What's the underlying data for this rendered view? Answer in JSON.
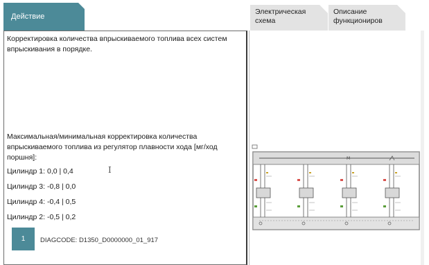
{
  "tabs": {
    "action": "Действие",
    "wiring": "Электрическая схема",
    "function": "Описание функциониров"
  },
  "content": {
    "message_top": "Корректировка количества впрыскиваемого топлива всех систем впрыскивания в порядке.",
    "message_mid": "Максимальная/минимальная корректировка количества впрыскиваемого топлива из регулятор плавности хода [мг/ход поршня]:",
    "cylinders": [
      "Цилиндр 1: 0,0 | 0,4",
      "Цилиндр 3: -0,8 | 0,0",
      "Цилиндр 4: -0,4 | 0,5",
      "Цилиндр 2: -0,5 | 0,2"
    ]
  },
  "footer": {
    "page_number": "1",
    "diagcode": "DIAGCODE: D1350_D0000000_01_917"
  },
  "colors": {
    "accent": "#4c8a98",
    "tab_inactive": "#e3e3e3"
  }
}
